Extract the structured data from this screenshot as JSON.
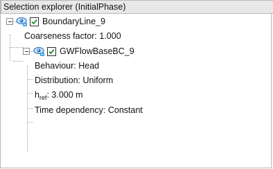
{
  "panel": {
    "title": "Selection explorer (InitialPhase)"
  },
  "tree": {
    "boundary": {
      "label": "BoundaryLine_9",
      "checked": true,
      "expanded": true,
      "coarseness": "Coarseness factor: 1.000"
    },
    "flow": {
      "label": "GWFlowBaseBC_9",
      "checked": true,
      "expanded": true,
      "behaviour": "Behaviour: Head",
      "distribution": "Distribution: Uniform",
      "href_symbol": "h",
      "href_sub": "ref",
      "href_value": ": 3.000 m",
      "time_dependency": "Time dependency: Constant"
    }
  },
  "colors": {
    "eye_blue": "#2f78c4",
    "check_green": "#1f8f2e"
  },
  "icons": [
    "visibility-eye-icon",
    "checkbox-checked-icon",
    "collapse-minus-icon"
  ]
}
